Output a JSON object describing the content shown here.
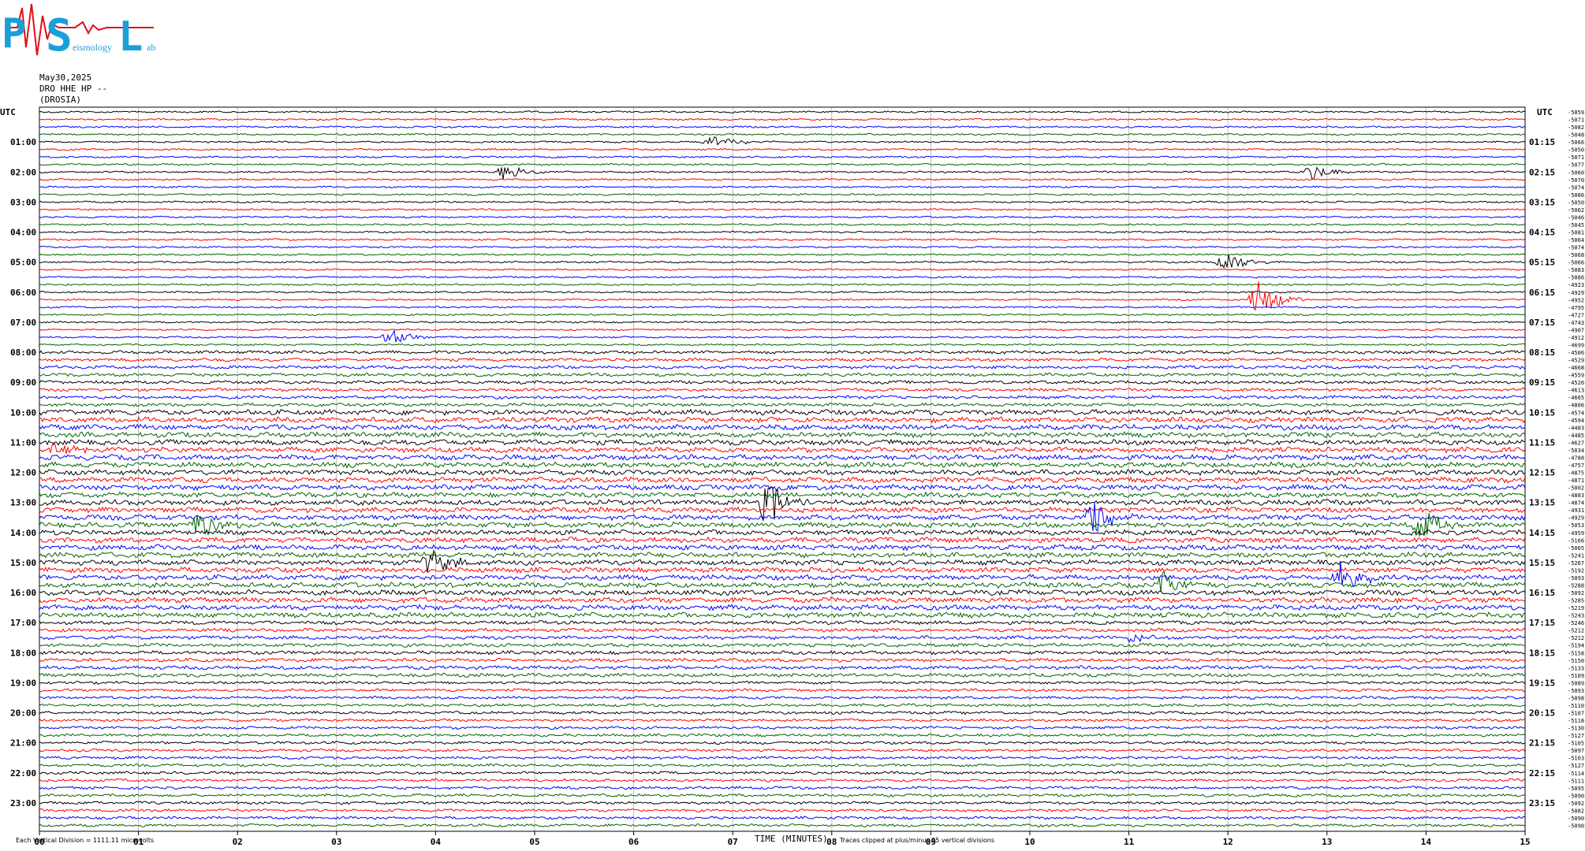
{
  "logo": {
    "letters": [
      "P",
      "S",
      "L"
    ],
    "words": [
      "eismology",
      "ab"
    ],
    "colors": {
      "letters": "#1aa0d8",
      "wave": "#e0101a"
    }
  },
  "header": {
    "date": "May30,2025",
    "station": "DRO HHE HP --",
    "location": "(DROSIA)"
  },
  "chart_data": {
    "type": "line",
    "description_text": {
      "utc_left": "UTC",
      "utc_right": "UTC",
      "xlabel": "TIME (MINUTES)",
      "footer_left": "Each Vertical Division = 1111.11 microvolts",
      "footer_right": "Traces clipped at plus/minus 25 vertical divisions"
    },
    "x_ticks": [
      "00",
      "01",
      "02",
      "03",
      "04",
      "05",
      "06",
      "07",
      "08",
      "09",
      "10",
      "11",
      "12",
      "13",
      "14",
      "15"
    ],
    "xlim": [
      0,
      15
    ],
    "grid": true,
    "left_hour_labels": [
      "01:00",
      "02:00",
      "03:00",
      "04:00",
      "05:00",
      "06:00",
      "07:00",
      "08:00",
      "09:00",
      "10:00",
      "11:00",
      "12:00",
      "13:00",
      "14:00",
      "15:00",
      "16:00",
      "17:00",
      "18:00",
      "19:00",
      "20:00",
      "21:00",
      "22:00",
      "23:00"
    ],
    "right_hour_labels": [
      "01:15",
      "02:15",
      "03:15",
      "04:15",
      "05:15",
      "06:15",
      "07:15",
      "08:15",
      "09:15",
      "10:15",
      "11:15",
      "12:15",
      "13:15",
      "14:15",
      "15:15",
      "16:15",
      "17:15",
      "18:15",
      "19:15",
      "20:15",
      "21:15",
      "22:15",
      "23:15"
    ],
    "trace_colors": [
      "#000000",
      "#ff0000",
      "#0000ff",
      "#006400"
    ],
    "trace_count": 96,
    "trace_offsets": [
      "-5059",
      "-5071",
      "-5082",
      "-5048",
      "-5066",
      "-5050",
      "-5071",
      "-5077",
      "-5060",
      "-5070",
      "-5074",
      "-5086",
      "-5050",
      "-5062",
      "-5046",
      "-5045",
      "-5081",
      "-5064",
      "-5074",
      "-5068",
      "-5066",
      "-5083",
      "-5086",
      "-4923",
      "-4929",
      "-4952",
      "-4795",
      "-4727",
      "-4743",
      "-4907",
      "-4912",
      "-4699",
      "-4506",
      "-4529",
      "-4668",
      "-4559",
      "-4526",
      "-4613",
      "-4665",
      "-4806",
      "-4574",
      "-4594",
      "-4483",
      "-4485",
      "-4627",
      "-5034",
      "-4788",
      "-4757",
      "-4875",
      "-4871",
      "-5002",
      "-4883",
      "-4874",
      "-4931",
      "-4929",
      "-5053",
      "-4959",
      "-5166",
      "-5065",
      "-5241",
      "-5267",
      "-5192",
      "-5093",
      "-5288",
      "-5092",
      "-5285",
      "-5219",
      "-5243",
      "-5246",
      "-5212",
      "-5212",
      "-5194",
      "-5158",
      "-5150",
      "-5133",
      "-5109",
      "-5089",
      "-5093",
      "-5098",
      "-5110",
      "-5107",
      "-5118",
      "-5130",
      "-5127",
      "-5105",
      "-5097",
      "-5103",
      "-5127",
      "-5114",
      "-5111",
      "-5095",
      "-5090",
      "-5092",
      "-5082",
      "-5090",
      "-5090"
    ],
    "events": [
      {
        "trace": 4,
        "minute": 6.8,
        "amplitude": 4
      },
      {
        "trace": 8,
        "minute": 4.7,
        "amplitude": 5
      },
      {
        "trace": 8,
        "minute": 12.85,
        "amplitude": 5
      },
      {
        "trace": 20,
        "minute": 11.98,
        "amplitude": 7
      },
      {
        "trace": 25,
        "minute": 12.3,
        "amplitude": 12
      },
      {
        "trace": 30,
        "minute": 3.55,
        "amplitude": 5
      },
      {
        "trace": 45,
        "minute": 0.15,
        "amplitude": 4
      },
      {
        "trace": 52,
        "minute": 7.35,
        "amplitude": 14
      },
      {
        "trace": 54,
        "minute": 10.65,
        "amplitude": 12
      },
      {
        "trace": 55,
        "minute": 1.6,
        "amplitude": 10
      },
      {
        "trace": 55,
        "minute": 13.95,
        "amplitude": 10
      },
      {
        "trace": 60,
        "minute": 3.95,
        "amplitude": 9
      },
      {
        "trace": 62,
        "minute": 13.15,
        "amplitude": 9
      },
      {
        "trace": 63,
        "minute": 11.35,
        "amplitude": 7
      },
      {
        "trace": 70,
        "minute": 11.05,
        "amplitude": 3
      }
    ]
  }
}
